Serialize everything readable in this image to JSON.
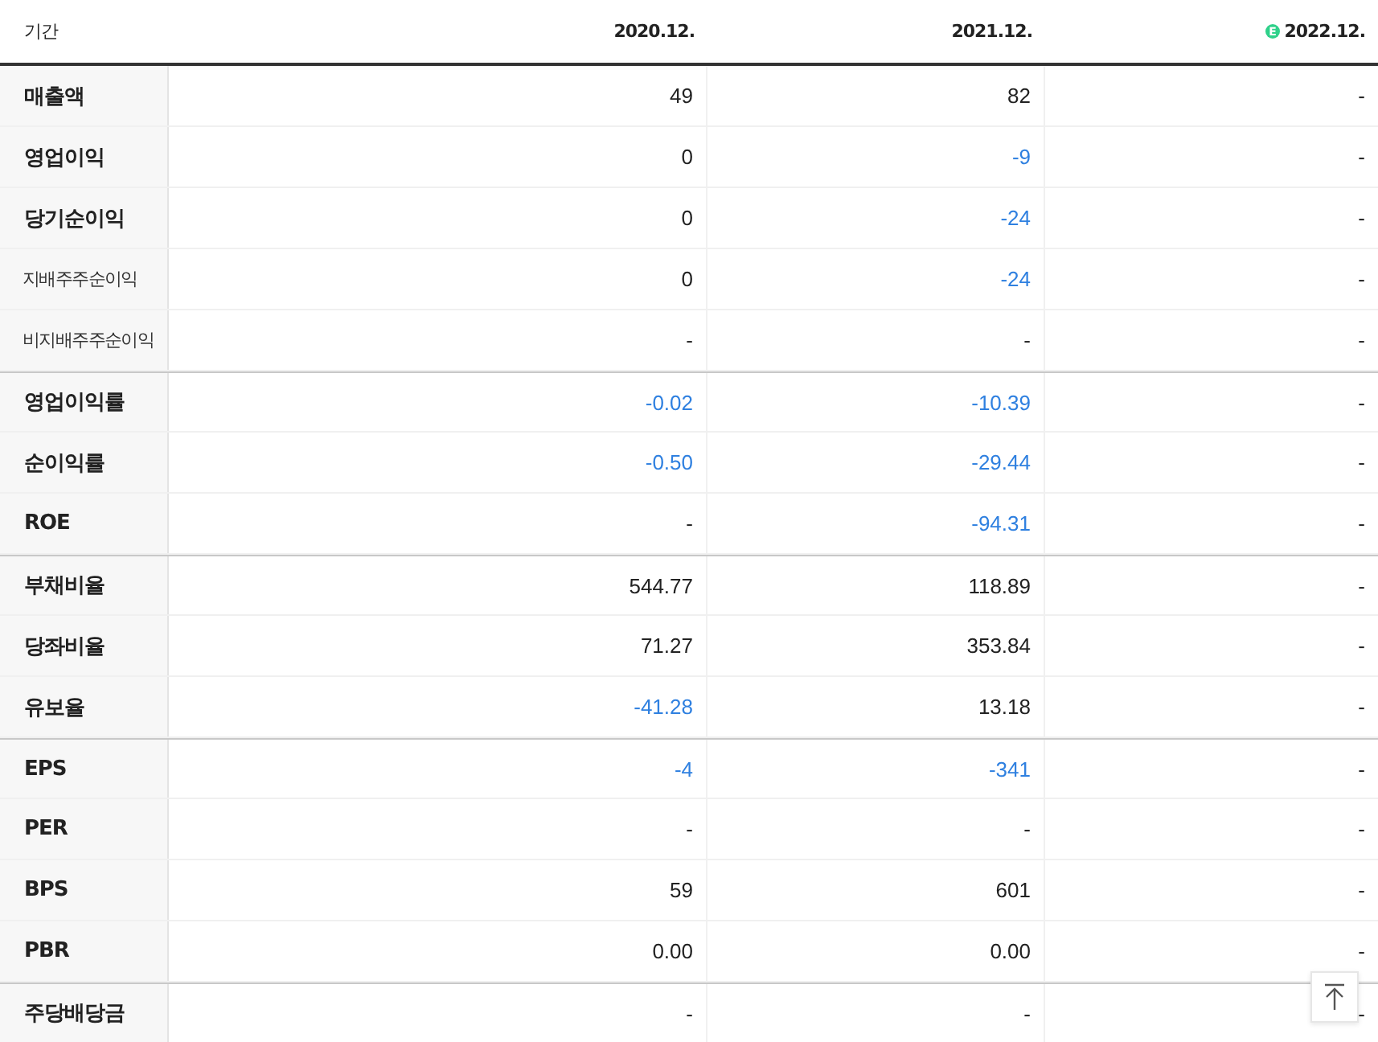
{
  "table": {
    "columns": [
      {
        "label": "기간"
      },
      {
        "label": "2020.12."
      },
      {
        "label": "2021.12."
      },
      {
        "label": "2022.12.",
        "badge": "E"
      }
    ],
    "groups": [
      {
        "rows": [
          {
            "label": "매출액",
            "kind": "main",
            "cells": [
              {
                "text": "49",
                "negative": false
              },
              {
                "text": "82",
                "negative": false
              },
              {
                "text": "-",
                "negative": false
              }
            ]
          },
          {
            "label": "영업이익",
            "kind": "main",
            "cells": [
              {
                "text": "0",
                "negative": false
              },
              {
                "text": "-9",
                "negative": true
              },
              {
                "text": "-",
                "negative": false
              }
            ]
          },
          {
            "label": "당기순이익",
            "kind": "main",
            "cells": [
              {
                "text": "0",
                "negative": false
              },
              {
                "text": "-24",
                "negative": true
              },
              {
                "text": "-",
                "negative": false
              }
            ]
          },
          {
            "label": "지배주주순이익",
            "kind": "sub",
            "cells": [
              {
                "text": "0",
                "negative": false
              },
              {
                "text": "-24",
                "negative": true
              },
              {
                "text": "-",
                "negative": false
              }
            ]
          },
          {
            "label": "비지배주주순이익",
            "kind": "sub",
            "cells": [
              {
                "text": "-",
                "negative": false
              },
              {
                "text": "-",
                "negative": false
              },
              {
                "text": "-",
                "negative": false
              }
            ]
          }
        ]
      },
      {
        "rows": [
          {
            "label": "영업이익률",
            "kind": "main",
            "cells": [
              {
                "text": "-0.02",
                "negative": true
              },
              {
                "text": "-10.39",
                "negative": true
              },
              {
                "text": "-",
                "negative": false
              }
            ]
          },
          {
            "label": "순이익률",
            "kind": "main",
            "cells": [
              {
                "text": "-0.50",
                "negative": true
              },
              {
                "text": "-29.44",
                "negative": true
              },
              {
                "text": "-",
                "negative": false
              }
            ]
          },
          {
            "label": "ROE",
            "kind": "main",
            "cells": [
              {
                "text": "-",
                "negative": false
              },
              {
                "text": "-94.31",
                "negative": true
              },
              {
                "text": "-",
                "negative": false
              }
            ]
          }
        ]
      },
      {
        "rows": [
          {
            "label": "부채비율",
            "kind": "main",
            "cells": [
              {
                "text": "544.77",
                "negative": false
              },
              {
                "text": "118.89",
                "negative": false
              },
              {
                "text": "-",
                "negative": false
              }
            ]
          },
          {
            "label": "당좌비율",
            "kind": "main",
            "cells": [
              {
                "text": "71.27",
                "negative": false
              },
              {
                "text": "353.84",
                "negative": false
              },
              {
                "text": "-",
                "negative": false
              }
            ]
          },
          {
            "label": "유보율",
            "kind": "main",
            "cells": [
              {
                "text": "-41.28",
                "negative": true
              },
              {
                "text": "13.18",
                "negative": false
              },
              {
                "text": "-",
                "negative": false
              }
            ]
          }
        ]
      },
      {
        "rows": [
          {
            "label": "EPS",
            "kind": "main",
            "cells": [
              {
                "text": "-4",
                "negative": true
              },
              {
                "text": "-341",
                "negative": true
              },
              {
                "text": "-",
                "negative": false
              }
            ]
          },
          {
            "label": "PER",
            "kind": "main",
            "cells": [
              {
                "text": "-",
                "negative": false
              },
              {
                "text": "-",
                "negative": false
              },
              {
                "text": "-",
                "negative": false
              }
            ]
          },
          {
            "label": "BPS",
            "kind": "main",
            "cells": [
              {
                "text": "59",
                "negative": false
              },
              {
                "text": "601",
                "negative": false
              },
              {
                "text": "-",
                "negative": false
              }
            ]
          },
          {
            "label": "PBR",
            "kind": "main",
            "cells": [
              {
                "text": "0.00",
                "negative": false
              },
              {
                "text": "0.00",
                "negative": false
              },
              {
                "text": "-",
                "negative": false
              }
            ]
          }
        ]
      },
      {
        "rows": [
          {
            "label": "주당배당금",
            "kind": "main",
            "cells": [
              {
                "text": "-",
                "negative": false
              },
              {
                "text": "-",
                "negative": false
              },
              {
                "text": "-",
                "negative": false
              }
            ]
          }
        ]
      }
    ]
  }
}
